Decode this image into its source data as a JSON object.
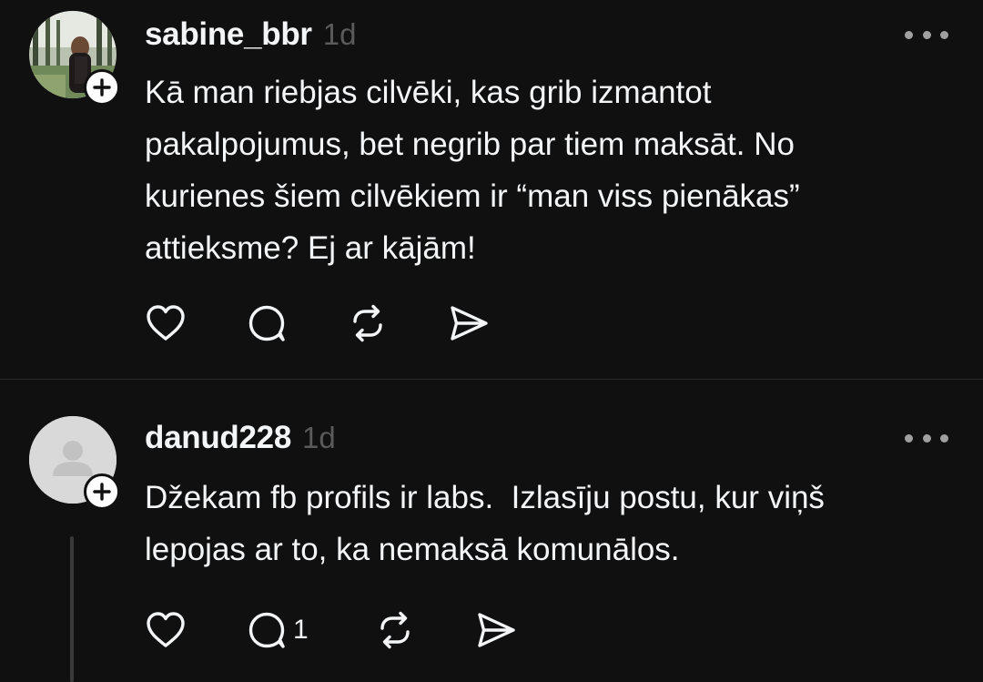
{
  "posts": [
    {
      "username": "sabine_bbr",
      "time": "1d",
      "text": "Kā man riebjas cilvēki, kas grib izmantot\npakalpojumus, bet negrib par tiem maksāt. No\nkurienes šiem cilvēkiem ir “man viss pienākas”\nattieksme? Ej ar kājām!",
      "avatar": "photo-avatar",
      "reply_count": ""
    },
    {
      "username": "danud228",
      "time": "1d",
      "text": "Džekam fb profils ir labs.  Izlasīju postu, kur viņš\nlepojas ar to, ka nemaksā komunālos.",
      "avatar": "default-avatar",
      "reply_count": "1"
    }
  ],
  "icons": {
    "like": "heart-icon",
    "reply": "comment-icon",
    "repost": "repost-icon",
    "share": "share-icon",
    "more": "more-icon",
    "follow": "plus-icon"
  },
  "colors": {
    "background": "#101010",
    "text": "#f3f5f7",
    "muted": "#5a5a5a",
    "divider": "#2b2b2b"
  }
}
